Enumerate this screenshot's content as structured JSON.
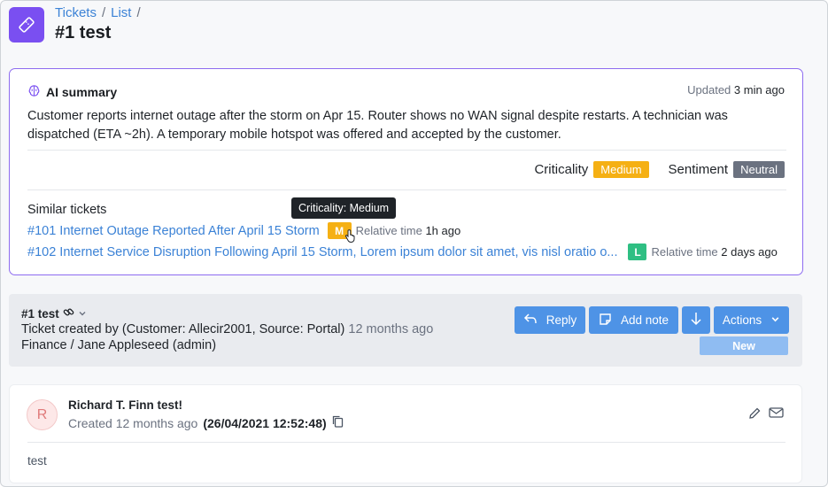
{
  "header": {
    "breadcrumb": [
      "Tickets",
      "List"
    ],
    "separator": "/",
    "title": "#1 test"
  },
  "ai_summary": {
    "title": "AI summary",
    "updated_label": "Updated",
    "updated_value": "3 min ago",
    "text": "Customer reports internet outage after the storm on Apr 15. Router shows no WAN signal despite restarts. A technician was dispatched (ETA ~2h). A temporary mobile hotspot was offered and accepted by the customer.",
    "criticality_label": "Criticality",
    "criticality_value": "Medium",
    "sentiment_label": "Sentiment",
    "sentiment_value": "Neutral",
    "similar_title": "Similar tickets",
    "tooltip": "Criticality: Medium",
    "similar": [
      {
        "title": "#101 Internet Outage Reported After April 15 Storm",
        "badge": "M",
        "badge_color": "#f5b014",
        "rel_label": "Relative time",
        "rel_value": "1h ago"
      },
      {
        "title": "#102 Internet Service Disruption Following April 15 Storm, Lorem ipsum dolor sit amet, vis nisl oratio o...",
        "badge": "L",
        "badge_color": "#2fbf83",
        "rel_label": "Relative time",
        "rel_value": "2 days ago"
      }
    ]
  },
  "ticket": {
    "title": "#1 test",
    "created_text": "Ticket created by (Customer: Allecir2001, Source: Portal)",
    "created_ago": "12 months ago",
    "group": "Finance / Jane Appleseed (admin)",
    "buttons": {
      "reply": "Reply",
      "add_note": "Add note",
      "actions": "Actions"
    },
    "status": "New"
  },
  "message": {
    "avatar_letter": "R",
    "author": "Richard T. Finn test!",
    "created_prefix": "Created 12 months ago",
    "created_date": "(26/04/2021 12:52:48)",
    "body": "test"
  },
  "colors": {
    "accent": "#7a4ff1",
    "link": "#3b82d6",
    "button": "#4e93e6"
  }
}
